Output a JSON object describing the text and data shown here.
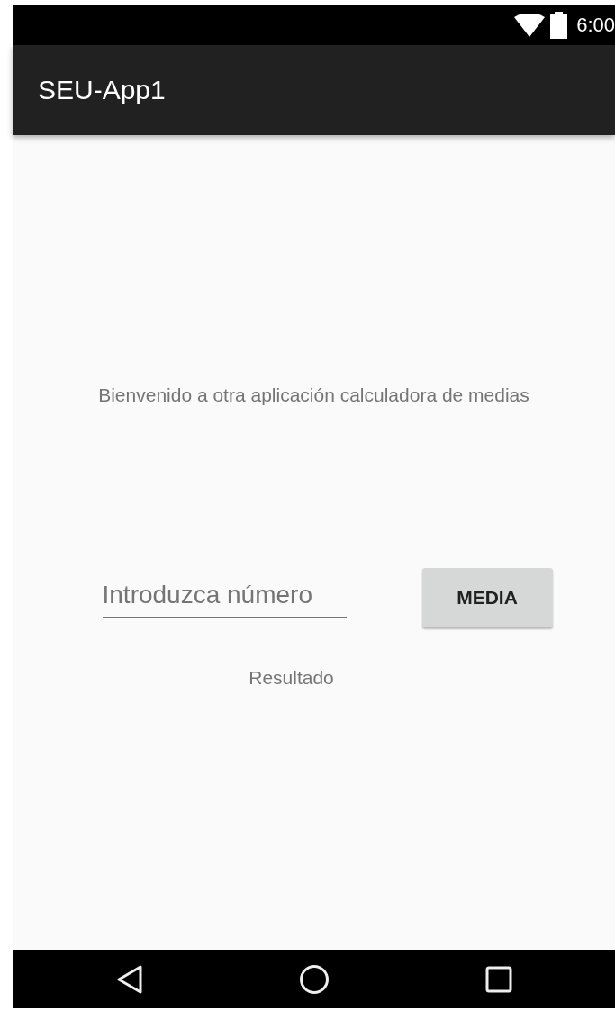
{
  "status_bar": {
    "time": "6:00"
  },
  "app_bar": {
    "title": "SEU-App1"
  },
  "welcome": "Bienvenido a otra aplicación calculadora de medias",
  "number_field": {
    "placeholder": "Introduzca número"
  },
  "buttons": [
    "MEDIA"
  ],
  "result": "Resultado"
}
